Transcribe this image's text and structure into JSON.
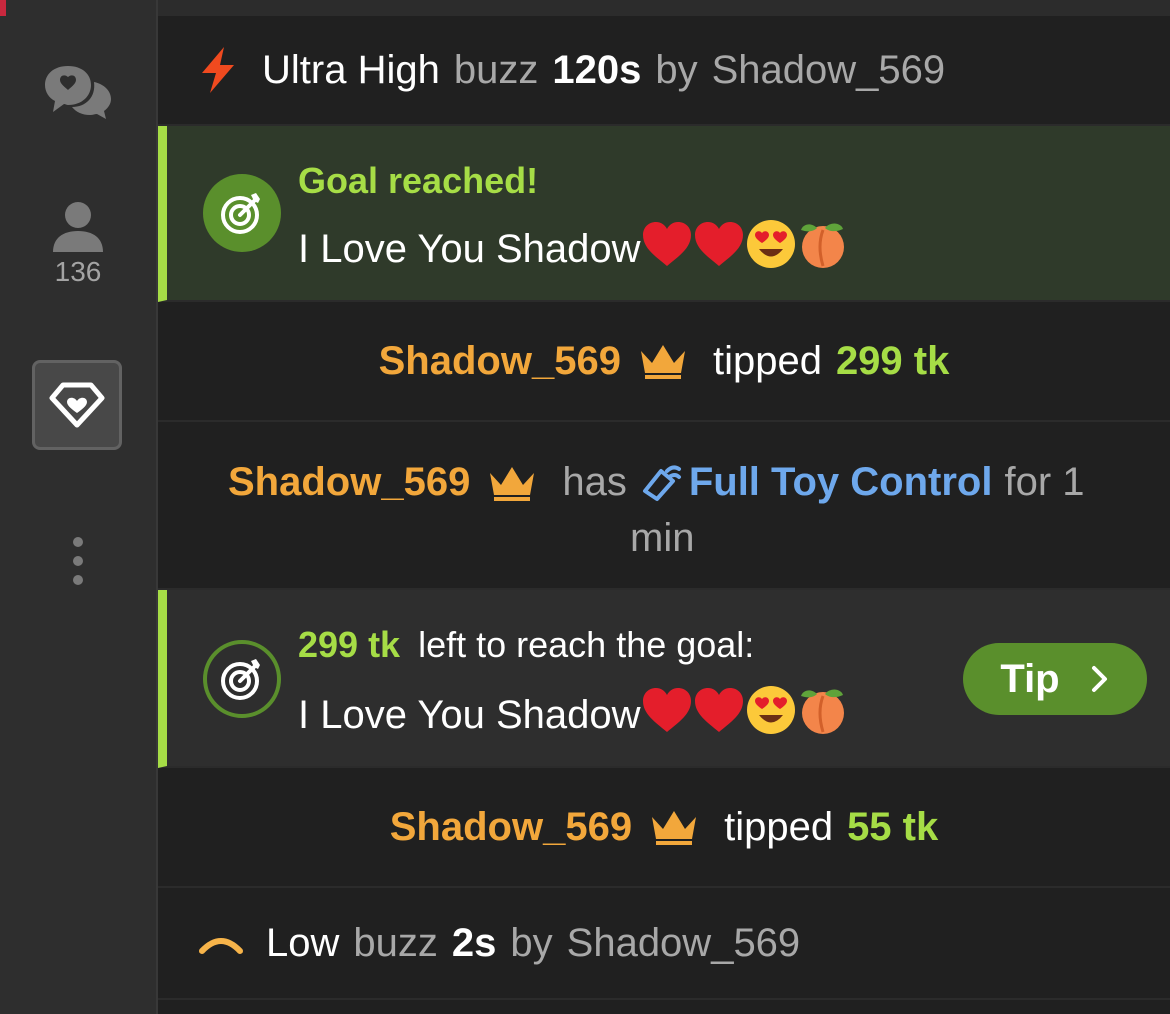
{
  "sidebar": {
    "viewer_count": "136"
  },
  "messages": {
    "buzz_high": {
      "level": "Ultra High",
      "word": "buzz",
      "duration": "120s",
      "by": "by",
      "user": "Shadow_569"
    },
    "goal_reached": {
      "title": "Goal reached!",
      "goal_text": "I Love You Shadow"
    },
    "tip1": {
      "user": "Shadow_569",
      "action": "tipped",
      "amount": "299 tk"
    },
    "control": {
      "user": "Shadow_569",
      "has": "has",
      "feature": "Full Toy Control",
      "for_text": "for 1",
      "duration_unit": "min"
    },
    "goal_progress": {
      "amount": "299 tk",
      "text": "left to reach the goal:",
      "goal_text": "I Love You Shadow",
      "tip_label": "Tip"
    },
    "tip2": {
      "user": "Shadow_569",
      "action": "tipped",
      "amount": "55 tk"
    },
    "buzz_low": {
      "level": "Low",
      "word": "buzz",
      "duration": "2s",
      "by": "by",
      "user": "Shadow_569"
    }
  },
  "colors": {
    "accent_green": "#a6dd46",
    "username_orange": "#f2a73b",
    "feature_blue": "#6ea8ec",
    "tip_button": "#5a8f2c",
    "lightning_red": "#f04a1f"
  }
}
